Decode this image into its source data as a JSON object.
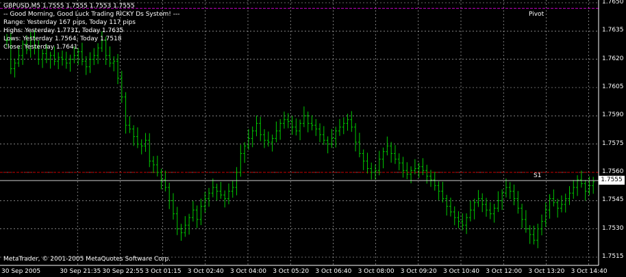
{
  "chart": {
    "header": "GBPUSD,M5  1.7555 1.7555 1.7553 1.7555",
    "info_lines": [
      "-- Good Morning, Good Luck Trading RICKY Ds System! ---",
      "Range: Yesterday 167 pips, Today 117 pips",
      "Highs: Yesterday 1.7731, Today 1.7635",
      "Lows: Yesterday 1.7564, Today 1.7518",
      "Close: Yesterday 1.7641"
    ],
    "copyright": "MetaTrader, © 2001-2005 MetaQuotes Software Corp.",
    "current_price": "1.7555",
    "price_axis": [
      "1.7650",
      "1.7635",
      "1.7620",
      "1.7605",
      "1.7590",
      "1.7575",
      "1.7560",
      "1.7545",
      "1.7530",
      "1.7515"
    ],
    "time_axis": [
      "30 Sep 2005",
      "30 Sep 21:35",
      "30 Sep 22:55",
      "3 Oct 01:15",
      "3 Oct 02:40",
      "3 Oct 04:00",
      "3 Oct 05:20",
      "3 Oct 06:40",
      "3 Oct 08:00",
      "3 Oct 09:20",
      "3 Oct 10:40",
      "3 Oct 12:00",
      "3 Oct 13:20",
      "3 Oct 14:40"
    ],
    "levels": {
      "pivot": {
        "label": "Pivot",
        "value": 1.7647,
        "color": "#cc00cc"
      },
      "s1": {
        "label": "S1",
        "value": 1.756,
        "color": "#cc0000"
      }
    },
    "colors": {
      "background": "#000000",
      "bars": "#00cc00",
      "grid": "#cfcfcf",
      "text": "#ffffff"
    }
  },
  "chart_data": {
    "type": "ohlc",
    "title": "GBPUSD,M5",
    "ylim": [
      1.7512,
      1.7652
    ],
    "y_ticks": [
      1.765,
      1.7635,
      1.762,
      1.7605,
      1.759,
      1.7575,
      1.756,
      1.7545,
      1.753,
      1.7515
    ],
    "x_tick_labels": [
      "30 Sep 2005",
      "30 Sep 21:35",
      "30 Sep 22:55",
      "3 Oct 01:15",
      "3 Oct 02:40",
      "3 Oct 04:00",
      "3 Oct 05:20",
      "3 Oct 06:40",
      "3 Oct 08:00",
      "3 Oct 09:20",
      "3 Oct 10:40",
      "3 Oct 12:00",
      "3 Oct 13:20",
      "3 Oct 14:40"
    ],
    "last": 1.7555,
    "close_series": [
      1.763,
      1.7615,
      1.7618,
      1.7622,
      1.7628,
      1.7625,
      1.7632,
      1.7626,
      1.762,
      1.7623,
      1.762,
      1.7622,
      1.7619,
      1.7621,
      1.762,
      1.7618,
      1.762,
      1.7622,
      1.7624,
      1.7619,
      1.7616,
      1.762,
      1.7622,
      1.7626,
      1.763,
      1.7622,
      1.7618,
      1.7619,
      1.761,
      1.76,
      1.7585,
      1.7583,
      1.7579,
      1.7575,
      1.7574,
      1.7577,
      1.7566,
      1.7564,
      1.756,
      1.7556,
      1.7552,
      1.7545,
      1.7538,
      1.753,
      1.7528,
      1.7532,
      1.7536,
      1.754,
      1.7535,
      1.7542,
      1.7546,
      1.7549,
      1.7552,
      1.755,
      1.7548,
      1.7546,
      1.755,
      1.7552,
      1.756,
      1.757,
      1.7574,
      1.7578,
      1.7582,
      1.7586,
      1.758,
      1.7577,
      1.7576,
      1.7578,
      1.7582,
      1.7586,
      1.7588,
      1.7587,
      1.7584,
      1.7582,
      1.7586,
      1.759,
      1.7586,
      1.7585,
      1.7583,
      1.758,
      1.7577,
      1.7575,
      1.7578,
      1.7582,
      1.7584,
      1.7586,
      1.7588,
      1.7584,
      1.7576,
      1.757,
      1.7566,
      1.7562,
      1.756,
      1.7561,
      1.7567,
      1.7571,
      1.7574,
      1.757,
      1.7567,
      1.7565,
      1.7561,
      1.7559,
      1.7561,
      1.7562,
      1.7563,
      1.7561,
      1.7558,
      1.7556,
      1.7553,
      1.755,
      1.7546,
      1.7542,
      1.7539,
      1.7536,
      1.7534,
      1.7532,
      1.7536,
      1.754,
      1.7544,
      1.7546,
      1.7543,
      1.754,
      1.7538,
      1.7541,
      1.7545,
      1.7549,
      1.7552,
      1.755,
      1.7546,
      1.7541,
      1.7535,
      1.753,
      1.7527,
      1.7524,
      1.753,
      1.7534,
      1.754,
      1.7546,
      1.7544,
      1.7541,
      1.7543,
      1.7546,
      1.7549,
      1.7552,
      1.7556,
      1.7554,
      1.755,
      1.7553,
      1.7555
    ]
  }
}
